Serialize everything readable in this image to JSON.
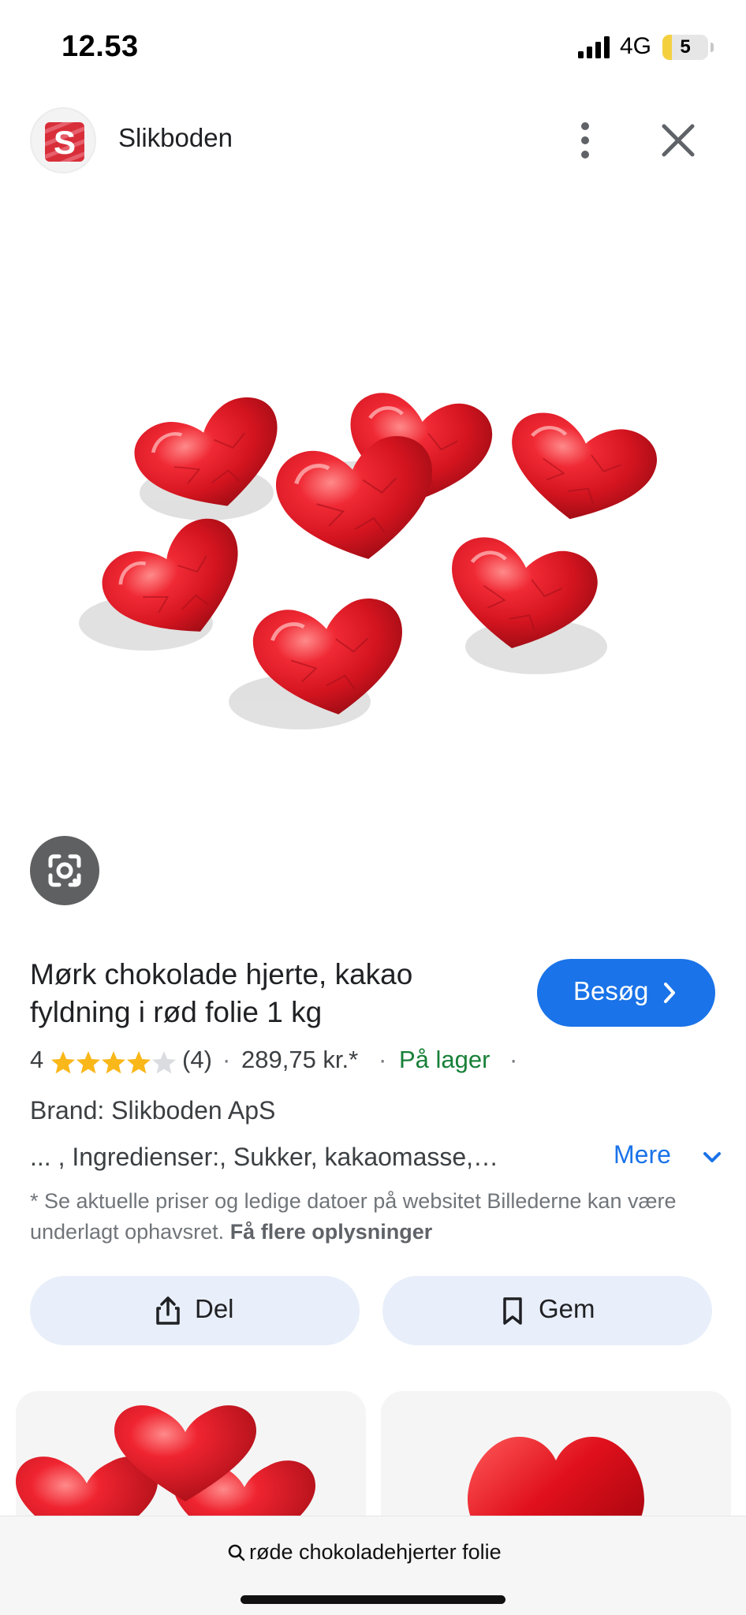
{
  "status_bar": {
    "time": "12.53",
    "network": "4G",
    "battery_level": "5",
    "battery_fraction": 0.05,
    "battery_color": "#f4d03f",
    "signal_bars": 4,
    "icons": [
      "signal-icon",
      "battery-icon"
    ]
  },
  "header": {
    "site_name": "Slikboden",
    "logo_letter": "S",
    "brand_color": "#d82e3a",
    "icons": [
      "site-logo-icon",
      "more-vert-icon",
      "close-icon"
    ]
  },
  "lens": {
    "icon": "lens-icon"
  },
  "product": {
    "title": "Mørk chokolade hjerte, kakao fyldning i rød folie 1 kg",
    "visit_label": "Besøg",
    "rating_value": "4",
    "rating_stars": 4,
    "rating_max": 5,
    "review_count": "(4)",
    "separator": "·",
    "price": "289,75 kr.*",
    "stock": "På lager",
    "brand": "Brand: Slikboden ApS",
    "ingredients": "... , Ingredienser:, Sukker, kakaomasse,…",
    "more_label": "Mere",
    "accent_color": "#1a73e8",
    "stock_color": "#188038",
    "star_color": "#f9b719"
  },
  "disclaimer": {
    "text": "* Se aktuelle priser og ledige datoer på websitet Billederne kan være underlagt ophavsret.",
    "link": "Få flere oplysninger"
  },
  "actions": {
    "share_label": "Del",
    "save_label": "Gem",
    "icons": [
      "share-icon",
      "bookmark-icon"
    ]
  },
  "search_bar": {
    "query": "røde chokoladehjerter folie",
    "icon": "search-icon"
  }
}
